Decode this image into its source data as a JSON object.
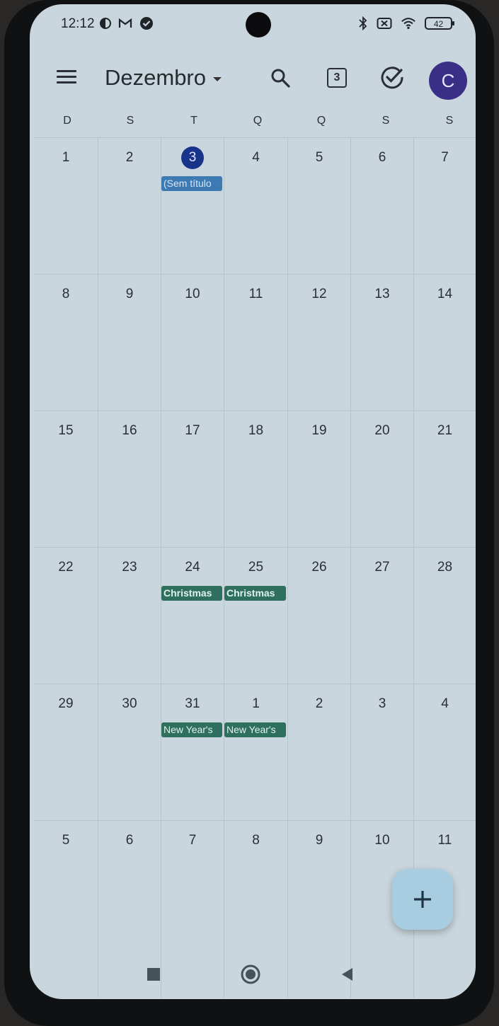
{
  "status": {
    "time": "12:12",
    "battery": "42",
    "icons": [
      "data-saver-icon",
      "gmail-icon",
      "check-badge-icon",
      "bluetooth-icon",
      "no-sim-icon",
      "wifi-icon",
      "battery-icon"
    ]
  },
  "appbar": {
    "month": "Dezembro",
    "today_number": "3",
    "avatar_letter": "C",
    "icons": [
      "menu-icon",
      "search-icon",
      "today-icon",
      "tasks-check-icon"
    ]
  },
  "weekdays": [
    "D",
    "S",
    "T",
    "Q",
    "Q",
    "S",
    "S"
  ],
  "weeks": [
    {
      "days": [
        "1",
        "2",
        "3",
        "4",
        "5",
        "6",
        "7"
      ]
    },
    {
      "days": [
        "8",
        "9",
        "10",
        "11",
        "12",
        "13",
        "14"
      ]
    },
    {
      "days": [
        "15",
        "16",
        "17",
        "18",
        "19",
        "20",
        "21"
      ]
    },
    {
      "days": [
        "22",
        "23",
        "24",
        "25",
        "26",
        "27",
        "28"
      ]
    },
    {
      "days": [
        "29",
        "30",
        "31",
        "1",
        "2",
        "3",
        "4"
      ]
    },
    {
      "days": [
        "5",
        "6",
        "7",
        "8",
        "9",
        "10",
        "11"
      ]
    }
  ],
  "events": {
    "dec3": "(Sem título",
    "dec24": "Christmas",
    "dec25": "Christmas",
    "dec31": "New Year's",
    "jan1": "New Year's"
  },
  "colors": {
    "screen": "#c9d6dd",
    "today_circle": "#17338a",
    "event_blue": "#3d7ab4",
    "event_green": "#2f6f5e",
    "avatar": "#3b2e87",
    "fab": "#a8cde0"
  }
}
